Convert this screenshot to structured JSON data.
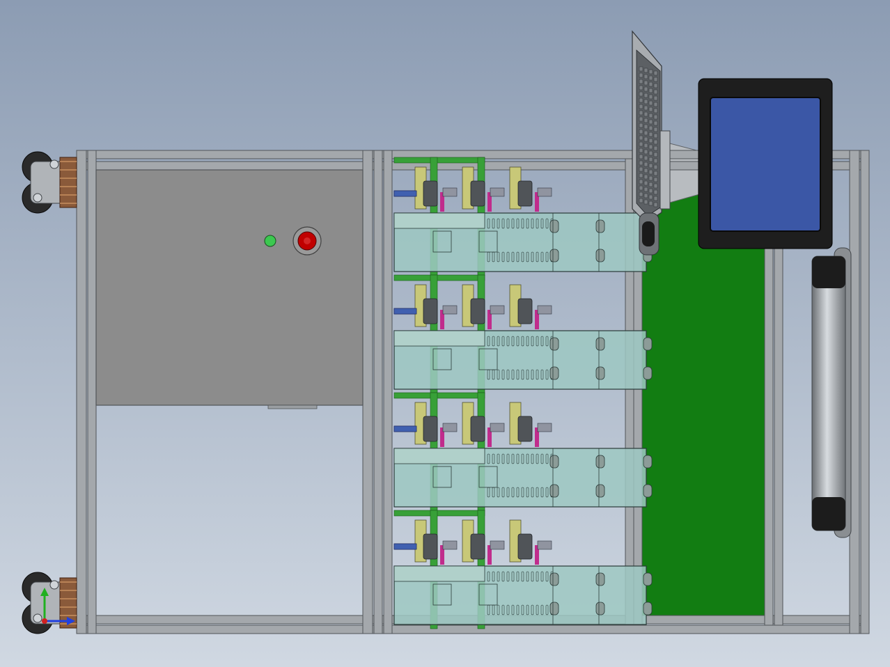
{
  "colors": {
    "background_top": "#8c9cb3",
    "background_bottom": "#d0d8e2",
    "frame": "#a4a8ac",
    "frame_edge": "#505458",
    "panel": "#8c8c8c",
    "panel_lower": "#c2c8d0",
    "green_board": "#127d12",
    "module_glass": "#9ec8c2",
    "screen": "#3b57a6",
    "bezel": "#1e1e1e",
    "indicator_green": "#3cc850",
    "stop_button": "#c00000",
    "accent_magenta": "#c02c8c",
    "accent_blue": "#4060b0",
    "accent_yellow": "#c8c878",
    "pcb_green": "#38a038"
  },
  "icons": {
    "axis_triad": "xyz-axis-icon",
    "caster": "caster-wheel-icon"
  },
  "modules": {
    "rows": 4,
    "pins_per_row": 3
  }
}
